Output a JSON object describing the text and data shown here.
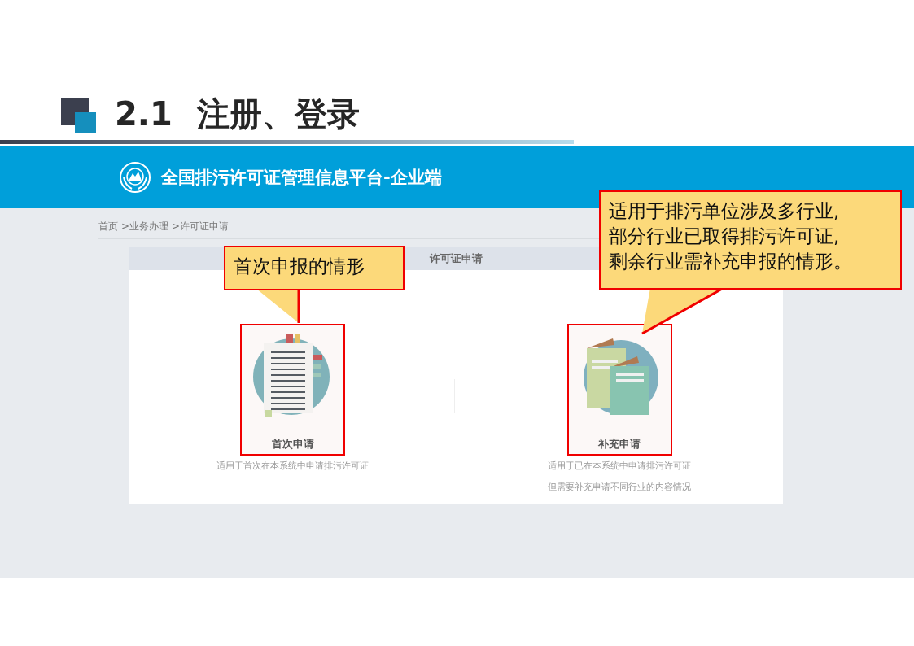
{
  "slide": {
    "number": "2.1",
    "title": "注册、登录"
  },
  "header": {
    "title": "全国排污许可证管理信息平台-企业端"
  },
  "breadcrumb": [
    "首页",
    ">业务办理",
    ">许可证申请"
  ],
  "panel": {
    "title": "许可证申请",
    "options": [
      {
        "kind": "document",
        "label": "首次申请",
        "description": [
          "适用于首次在本系统中申请排污许可证"
        ]
      },
      {
        "kind": "folders",
        "label": "补充申请",
        "description": [
          "适用于已在本系统中申请排污许可证",
          "但需要补充申请不同行业的内容情况"
        ]
      }
    ]
  },
  "callouts": [
    {
      "lines": [
        "首次申报的情形"
      ]
    },
    {
      "lines": [
        "适用于排污单位涉及多行业,",
        "部分行业已取得排污许可证,",
        "剩余行业需补充申报的情形。"
      ]
    }
  ]
}
